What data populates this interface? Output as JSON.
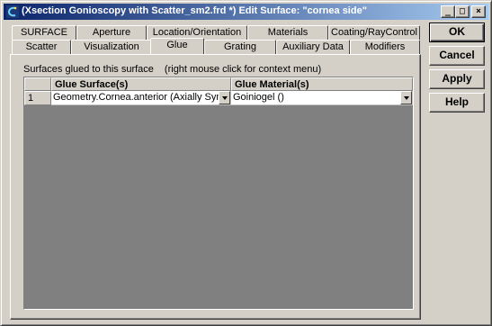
{
  "window": {
    "title": "(Xsection Gonioscopy with Scatter_sm2.frd *) Edit Surface: \"cornea side\"",
    "controls": {
      "minimize": "_",
      "maximize": "□",
      "close": "×"
    }
  },
  "tabs_row1": [
    "SURFACE",
    "Aperture",
    "Location/Orientation",
    "Materials",
    "Coating/RayControl"
  ],
  "tabs_row2": [
    "Scatter",
    "Visualization",
    "Glue",
    "Grating",
    "Auxiliary Data",
    "Modifiers"
  ],
  "active_tab": "Glue",
  "panel": {
    "hint_label": "Surfaces glued to this surface",
    "hint_context": "(right mouse click for context menu)"
  },
  "table": {
    "headers": [
      "Glue Surface(s)",
      "Glue Material(s)"
    ],
    "rows": [
      {
        "index": "1",
        "surface": "Geometry.Cornea.anterior  (Axially Symmetr",
        "material": "Goiniogel  ()"
      }
    ]
  },
  "buttons": {
    "ok": "OK",
    "cancel": "Cancel",
    "apply": "Apply",
    "help": "Help"
  }
}
